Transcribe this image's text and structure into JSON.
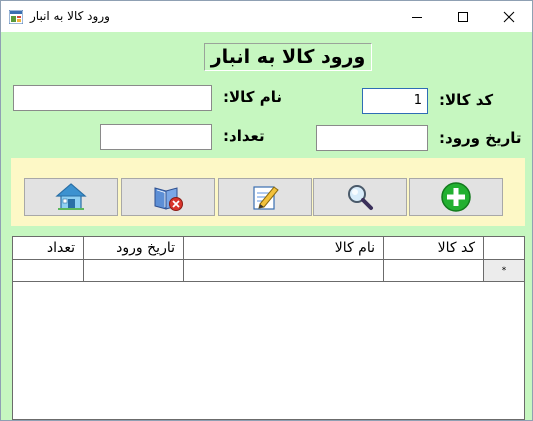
{
  "window": {
    "title": "ورود کالا به انبار",
    "controls": [
      "minimize",
      "maximize",
      "close"
    ]
  },
  "form": {
    "heading": "ورود کالا به انبار",
    "fields": {
      "code_label": "کد کالا:",
      "code_value": "1",
      "name_label": "نام کالا:",
      "name_value": "",
      "date_label": "تاریخ ورود:",
      "date_value": "",
      "qty_label": "تعداد:",
      "qty_value": ""
    }
  },
  "toolbar": {
    "buttons": [
      "add",
      "search",
      "edit",
      "delete",
      "home"
    ],
    "icons": [
      "plus-circle-icon",
      "magnifier-icon",
      "edit-note-icon",
      "delete-book-icon",
      "home-icon"
    ]
  },
  "grid": {
    "columns": [
      "کد کالا",
      "نام کالا",
      "تاریخ ورود",
      "تعداد"
    ],
    "rows": [],
    "new_row_marker": "*"
  },
  "colors": {
    "form_background": "#c6f7c0",
    "toolbar_background": "#fdf8c6",
    "add_green": "#22b030"
  }
}
